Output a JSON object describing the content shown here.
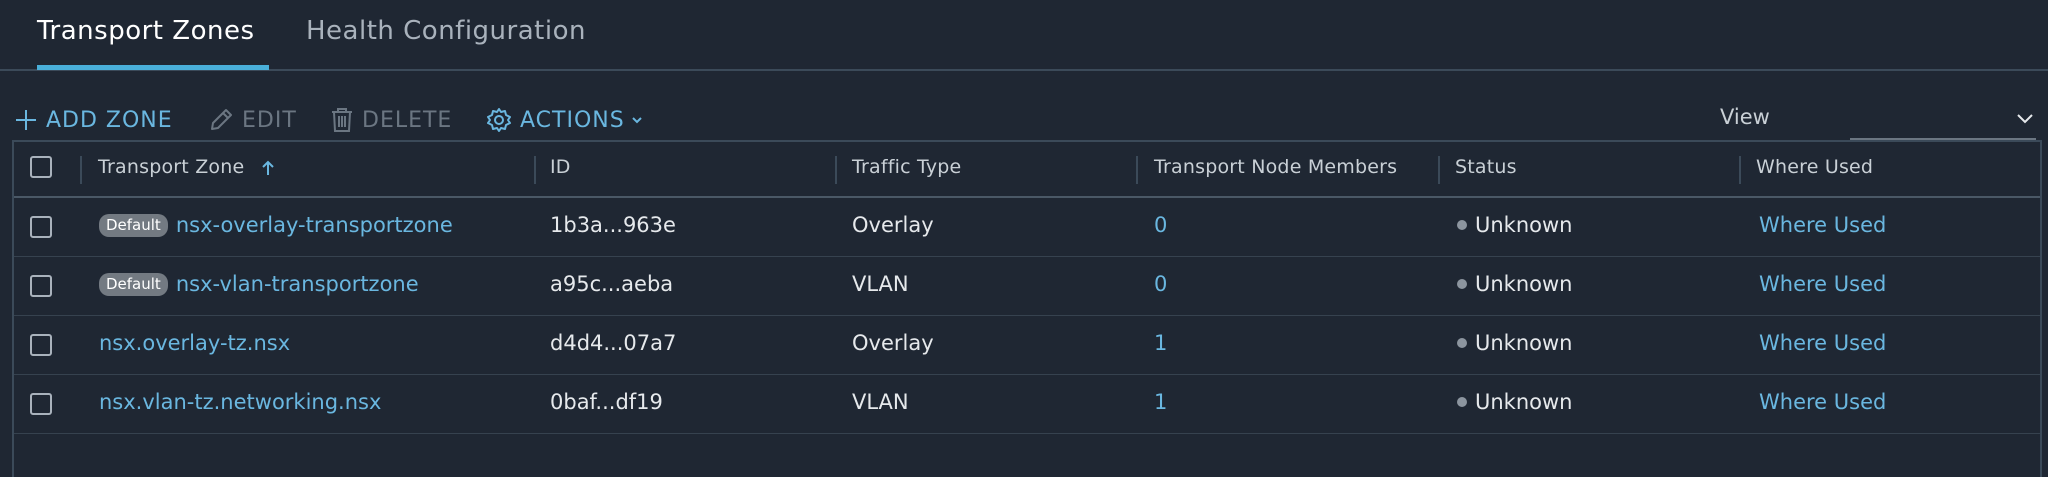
{
  "tabs": [
    {
      "label": "Transport Zones",
      "active": true
    },
    {
      "label": "Health Configuration",
      "active": false
    }
  ],
  "toolbar": {
    "add_label": "ADD ZONE",
    "edit_label": "EDIT",
    "delete_label": "DELETE",
    "actions_label": "ACTIONS",
    "view_label": "View"
  },
  "table": {
    "columns": [
      "Transport Zone",
      "ID",
      "Traffic Type",
      "Transport Node Members",
      "Status",
      "Where Used"
    ],
    "rows": [
      {
        "badge": "Default",
        "name": "nsx-overlay-transportzone",
        "id": "1b3a...963e",
        "traffic": "Overlay",
        "members": "0",
        "status": "Unknown",
        "where_used": "Where Used"
      },
      {
        "badge": "Default",
        "name": "nsx-vlan-transportzone",
        "id": "a95c...aeba",
        "traffic": "VLAN",
        "members": "0",
        "status": "Unknown",
        "where_used": "Where Used"
      },
      {
        "badge": "",
        "name": "nsx.overlay-tz.nsx",
        "id": "d4d4...07a7",
        "traffic": "Overlay",
        "members": "1",
        "status": "Unknown",
        "where_used": "Where Used"
      },
      {
        "badge": "",
        "name": "nsx.vlan-tz.networking.nsx",
        "id": "0baf...df19",
        "traffic": "VLAN",
        "members": "1",
        "status": "Unknown",
        "where_used": "Where Used"
      }
    ]
  },
  "colors": {
    "background": "#1f2733",
    "accent": "#49afd9",
    "link": "#6ab7e0",
    "disabled": "#6b7682",
    "badge": "#737a82",
    "status_unknown": "#8c959f"
  },
  "icons": {
    "add": "plus-icon",
    "edit": "pencil-icon",
    "delete": "trash-icon",
    "actions": "gear-icon",
    "actions_caret": "chevron-down-icon",
    "view_caret": "chevron-down-icon",
    "sort": "arrow-up-icon"
  }
}
